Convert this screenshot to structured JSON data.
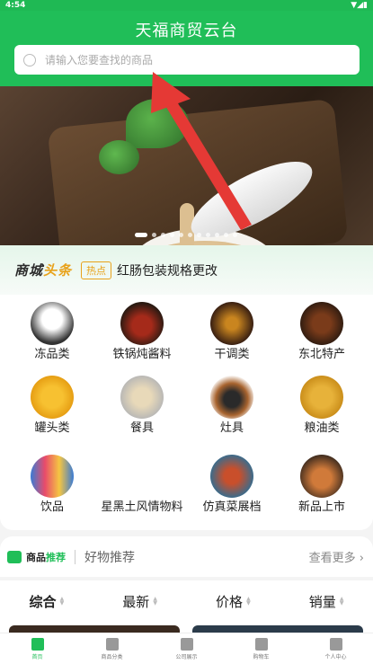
{
  "status": {
    "time": "4:54"
  },
  "header": {
    "title": "天福商贸云台"
  },
  "search": {
    "placeholder": "请输入您要查找的商品"
  },
  "banner": {
    "dot_count": 11,
    "active_index": 0
  },
  "news": {
    "logo_part1": "商城",
    "logo_part2": "头条",
    "tag": "热点",
    "text": "红肠包装规格更改"
  },
  "categories": [
    {
      "label": "冻品类"
    },
    {
      "label": "铁锅炖酱料"
    },
    {
      "label": "干调类"
    },
    {
      "label": "东北特产"
    },
    {
      "label": "罐头类"
    },
    {
      "label": "餐具"
    },
    {
      "label": "灶具"
    },
    {
      "label": "粮油类"
    },
    {
      "label": "饮品"
    },
    {
      "label": "星黑土风情物料"
    },
    {
      "label": "仿真菜展档"
    },
    {
      "label": "新品上市"
    }
  ],
  "recommend": {
    "title_a": "商品",
    "title_b": "推荐",
    "tab": "好物推荐",
    "more": "查看更多"
  },
  "sort": [
    {
      "label": "综合"
    },
    {
      "label": "最新"
    },
    {
      "label": "价格"
    },
    {
      "label": "销量"
    }
  ],
  "tabbar": [
    {
      "label": "首页"
    },
    {
      "label": "商品分类"
    },
    {
      "label": "公司展示"
    },
    {
      "label": "购物车"
    },
    {
      "label": "个人中心"
    }
  ],
  "colors": {
    "brand_green": "#20be58",
    "accent_orange": "#e8a21b",
    "arrow_red": "#e53935"
  }
}
